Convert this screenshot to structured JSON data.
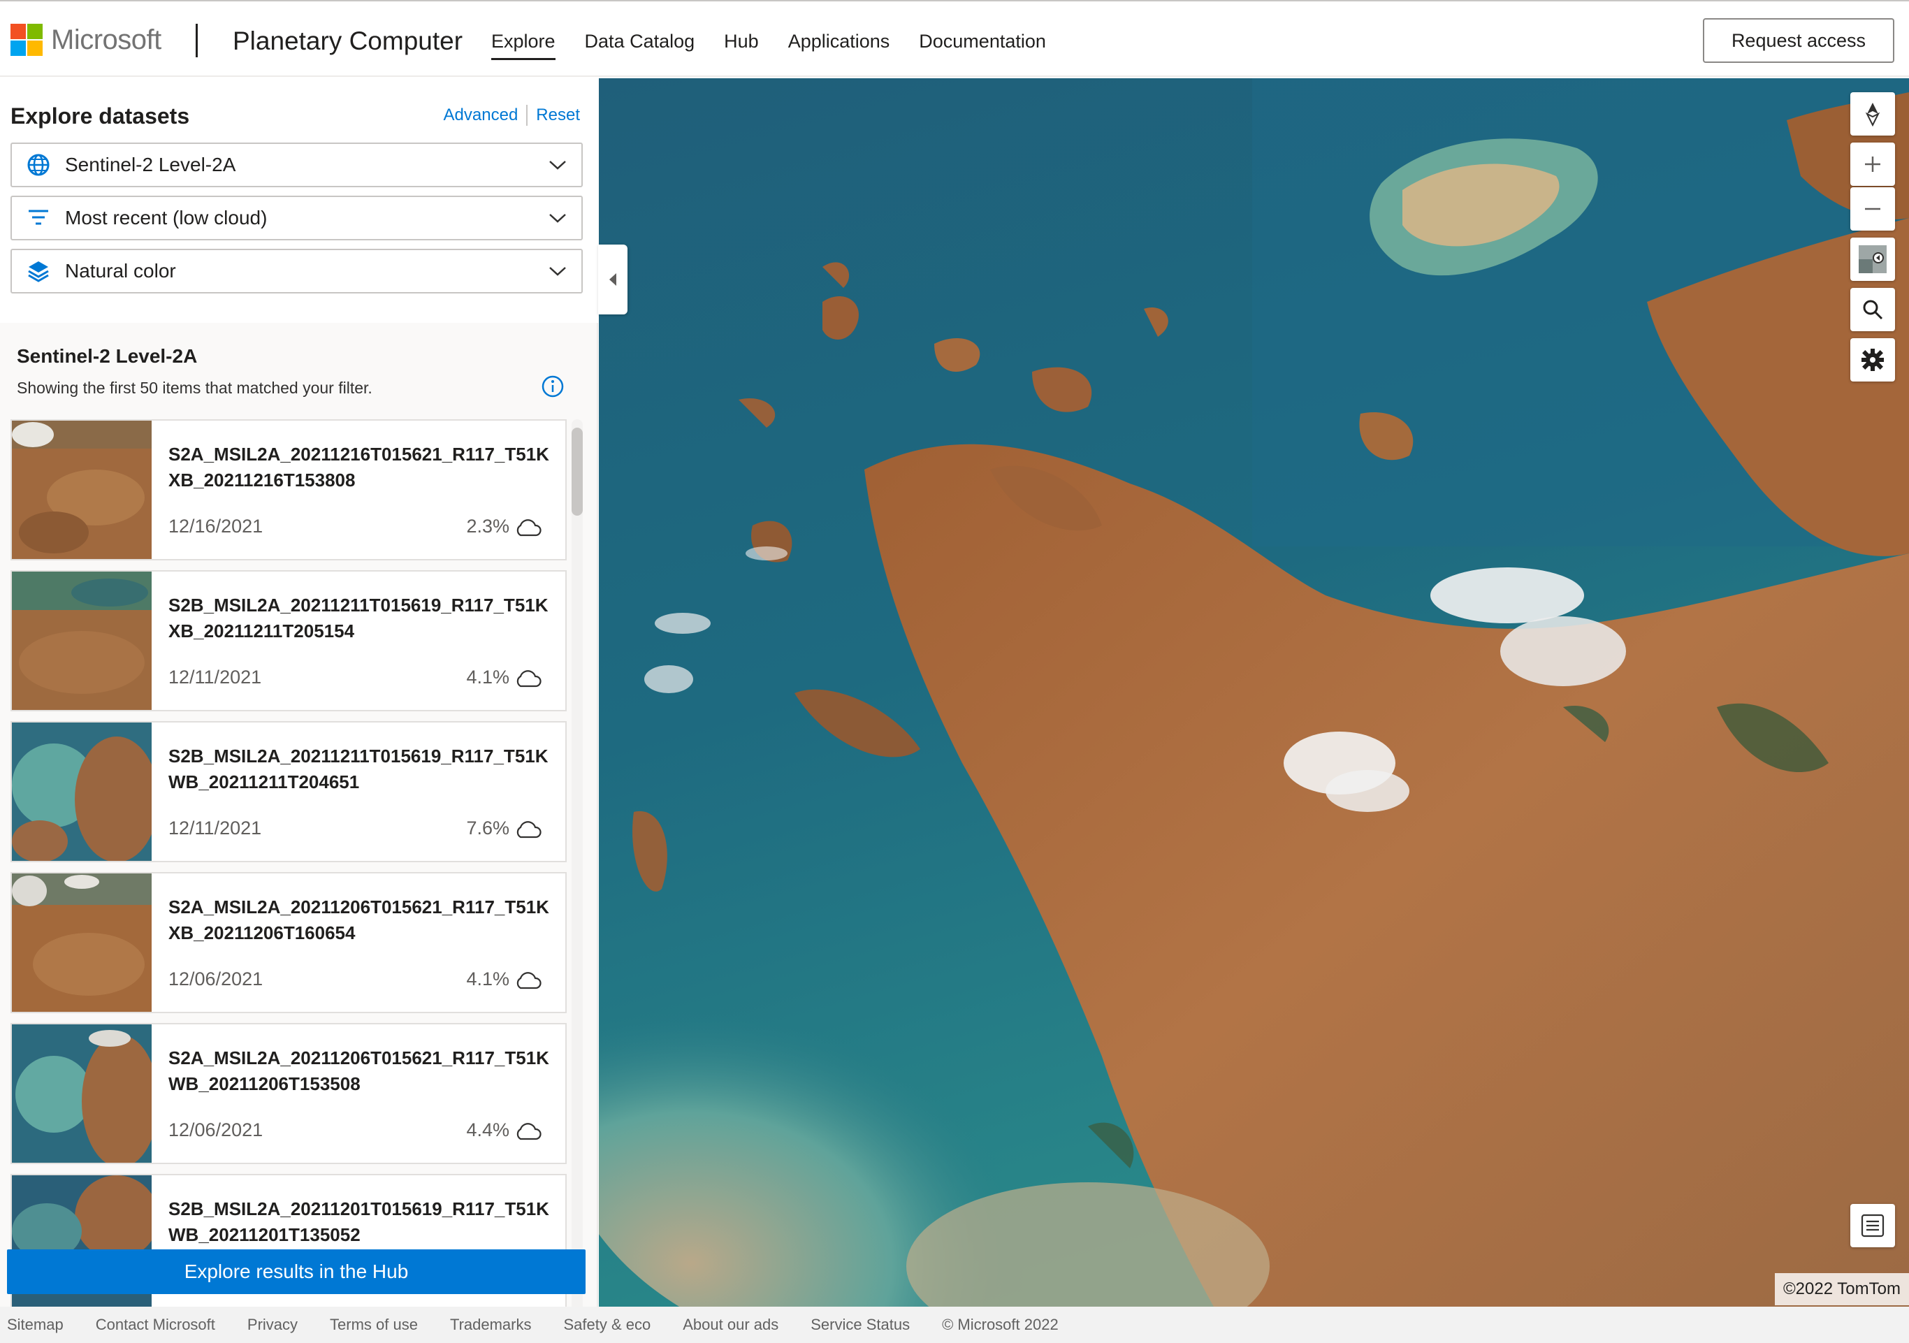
{
  "header": {
    "logo_text": "Microsoft",
    "brand": "Planetary Computer",
    "nav": [
      "Explore",
      "Data Catalog",
      "Hub",
      "Applications",
      "Documentation"
    ],
    "request_access": "Request access"
  },
  "panel": {
    "title": "Explore datasets",
    "advanced": "Advanced",
    "reset": "Reset",
    "dataset": "Sentinel-2 Level-2A",
    "filter": "Most recent (low cloud)",
    "rendering": "Natural color",
    "results_title": "Sentinel-2 Level-2A",
    "results_subtitle": "Showing the first 50 items that matched your filter.",
    "items": [
      {
        "id": "S2A_MSIL2A_20211216T015621_R117_T51KXB_20211216T153808",
        "date": "12/16/2021",
        "cloud": "2.3%"
      },
      {
        "id": "S2B_MSIL2A_20211211T015619_R117_T51KXB_20211211T205154",
        "date": "12/11/2021",
        "cloud": "4.1%"
      },
      {
        "id": "S2B_MSIL2A_20211211T015619_R117_T51KWB_20211211T204651",
        "date": "12/11/2021",
        "cloud": "7.6%"
      },
      {
        "id": "S2A_MSIL2A_20211206T015621_R117_T51KXB_20211206T160654",
        "date": "12/06/2021",
        "cloud": "4.1%"
      },
      {
        "id": "S2A_MSIL2A_20211206T015621_R117_T51KWB_20211206T153508",
        "date": "12/06/2021",
        "cloud": "4.4%"
      },
      {
        "id": "S2B_MSIL2A_20211201T015619_R117_T51KWB_20211201T135052",
        "date": "",
        "cloud": ""
      }
    ],
    "hub_button": "Explore results in the Hub"
  },
  "map": {
    "copyright": "©2022 TomTom"
  },
  "footer": [
    "Sitemap",
    "Contact Microsoft",
    "Privacy",
    "Terms of use",
    "Trademarks",
    "Safety & eco",
    "About our ads",
    "Service Status",
    "© Microsoft 2022"
  ],
  "colors": {
    "accent": "#0078d4",
    "ms_red": "#f25022",
    "ms_green": "#7fba00",
    "ms_blue": "#00a4ef",
    "ms_yellow": "#ffb900"
  }
}
